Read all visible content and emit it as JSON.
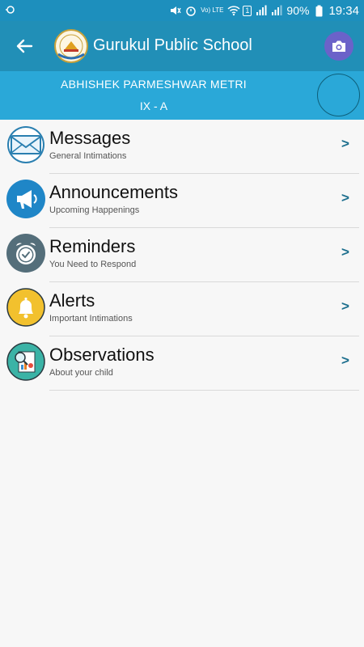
{
  "status_bar": {
    "battery": "90%",
    "time": "19:34",
    "network": "Vo) LTE",
    "sim": "1",
    "icons": [
      "link-icon",
      "mute-icon",
      "alarm-icon",
      "wifi-icon",
      "signal-icon",
      "battery-icon"
    ]
  },
  "app_bar": {
    "title": "Gurukul Public School",
    "back_icon": "arrow-left-icon",
    "camera_icon": "camera-icon",
    "colors": {
      "app_bar": "#218fb7",
      "status_bar": "#1d8fbd",
      "camera_button": "#6b62c9"
    }
  },
  "student": {
    "name": "ABHISHEK PARMESHWAR METRI",
    "class": "IX - A",
    "banner_color": "#2aa8d8"
  },
  "menu": [
    {
      "title": "Messages",
      "subtitle": "General Intimations",
      "chevron": ">",
      "icon": "envelope-icon",
      "icon_color": "#2a7fb0"
    },
    {
      "title": "Announcements",
      "subtitle": "Upcoming Happenings",
      "chevron": ">",
      "icon": "megaphone-icon",
      "icon_color": "#1f86c7"
    },
    {
      "title": "Reminders",
      "subtitle": "You Need to Respond",
      "chevron": ">",
      "icon": "alarm-clock-icon",
      "icon_color": "#546e7a"
    },
    {
      "title": "Alerts",
      "subtitle": "Important Intimations",
      "chevron": ">",
      "icon": "bell-icon",
      "icon_color": "#f2c12e"
    },
    {
      "title": "Observations",
      "subtitle": "About your child",
      "chevron": ">",
      "icon": "report-magnifier-icon",
      "icon_color": "#3bb3a6"
    }
  ]
}
